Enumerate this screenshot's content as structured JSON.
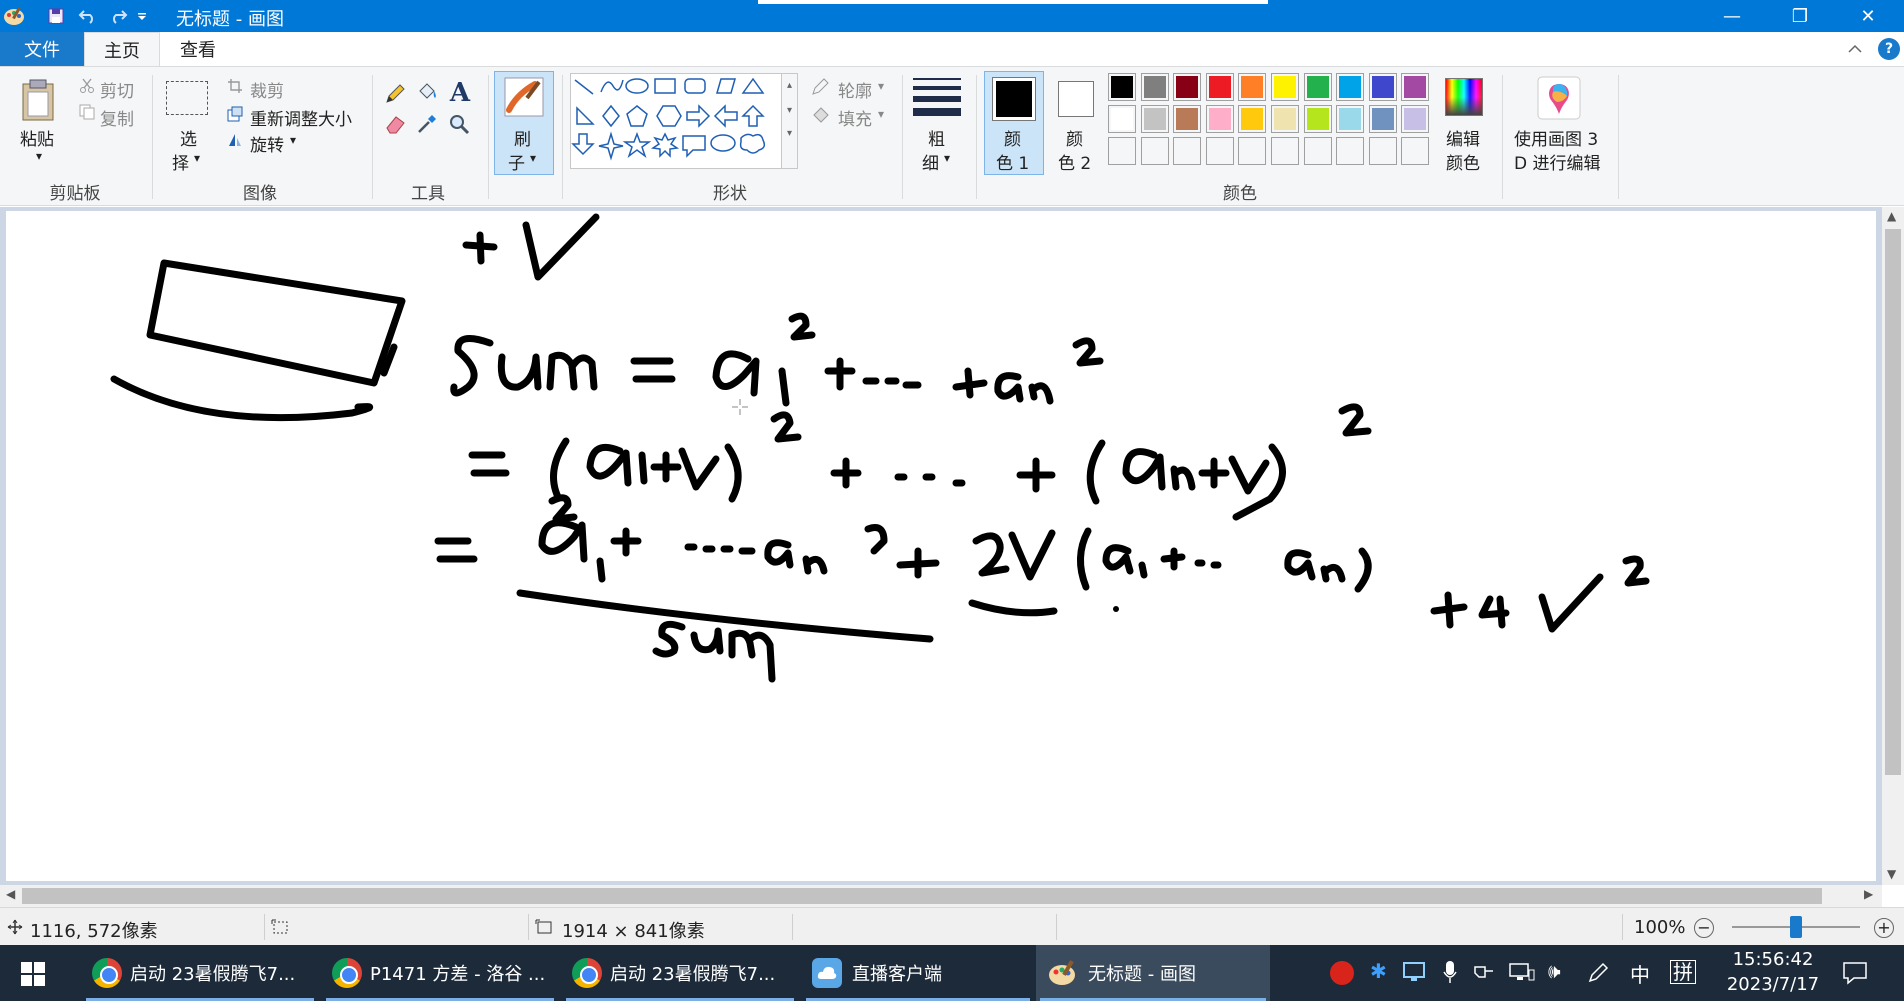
{
  "window": {
    "title": "无标题 - 画图",
    "minimize": "—",
    "restore": "❐",
    "close": "✕"
  },
  "tabs": {
    "file": "文件",
    "home": "主页",
    "view": "查看"
  },
  "clipboard": {
    "paste": "粘贴",
    "cut": "剪切",
    "copy": "复制",
    "label": "剪贴板"
  },
  "image": {
    "select_1": "选",
    "select_2": "择",
    "crop": "裁剪",
    "resize": "重新调整大小",
    "rotate": "旋转",
    "label": "图像"
  },
  "tools": {
    "label": "工具"
  },
  "brushes": {
    "label_1": "刷",
    "label_2": "子"
  },
  "shapes": {
    "outline": "轮廓",
    "fill": "填充",
    "label": "形状"
  },
  "size": {
    "label_1": "粗",
    "label_2": "细"
  },
  "colors": {
    "color1_a": "颜",
    "color1_b": "色 1",
    "color2_a": "颜",
    "color2_b": "色 2",
    "edit_a": "编辑",
    "edit_b": "颜色",
    "paint3d_a": "使用画图 3",
    "paint3d_b": "D 进行编辑",
    "label": "颜色",
    "palette_row1": [
      "#000000",
      "#7f7f7f",
      "#880015",
      "#ed1c24",
      "#ff7f27",
      "#fff200",
      "#22b14c",
      "#00a2e8",
      "#3f48cc",
      "#a349a4"
    ],
    "palette_row2": [
      "#ffffff",
      "#c3c3c3",
      "#b97a57",
      "#ffaec9",
      "#ffc90e",
      "#efe4b0",
      "#b5e61d",
      "#99d9ea",
      "#7092be",
      "#c8bfe7"
    ],
    "color1_value": "#000000",
    "color2_value": "#ffffff"
  },
  "status": {
    "cursor_pos": "1116, 572像素",
    "canvas_size": "1914 × 841像素",
    "zoom": "100%"
  },
  "taskbar": {
    "items": [
      "启动 23暑假腾飞7...",
      "P1471 方差 - 洛谷 ...",
      "启动 23暑假腾飞7...",
      "直播客户端",
      "无标题 - 画图"
    ],
    "ime1": "中",
    "ime2": "拼",
    "time": "15:56:42",
    "date": "2023/7/17"
  }
}
